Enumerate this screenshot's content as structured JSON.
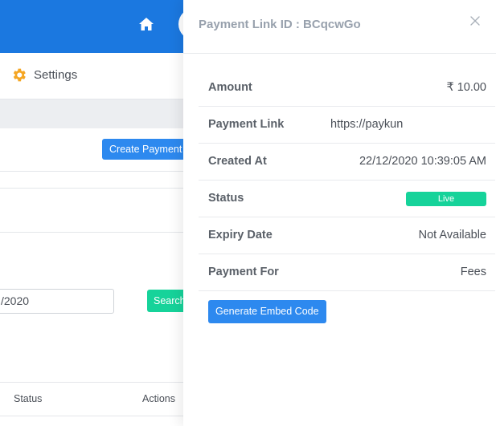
{
  "background": {
    "settings_label": "Settings",
    "create_button_label": "Create Payment Link",
    "date_input_value": "/2020",
    "search_button_label": "Search",
    "table_headers": [
      "Status",
      "Actions"
    ]
  },
  "panel": {
    "title": "Payment Link ID : BCqcwGo",
    "rows": [
      {
        "label": "Amount",
        "value": "₹ 10.00"
      },
      {
        "label": "Payment Link",
        "value": "https://paykun"
      },
      {
        "label": "Created At",
        "value": "22/12/2020 10:39:05 AM"
      },
      {
        "label": "Status",
        "value": "Live"
      },
      {
        "label": "Expiry Date",
        "value": "Not Available"
      },
      {
        "label": "Payment For",
        "value": "Fees"
      }
    ],
    "embed_button_label": "Generate Embed Code"
  },
  "colors": {
    "primary": "#2d89ef",
    "topbar": "#1b78e0",
    "success": "#16d39a",
    "settings_icon": "#f5a623"
  },
  "icons": [
    "home-icon",
    "gear-icon",
    "close-icon"
  ]
}
